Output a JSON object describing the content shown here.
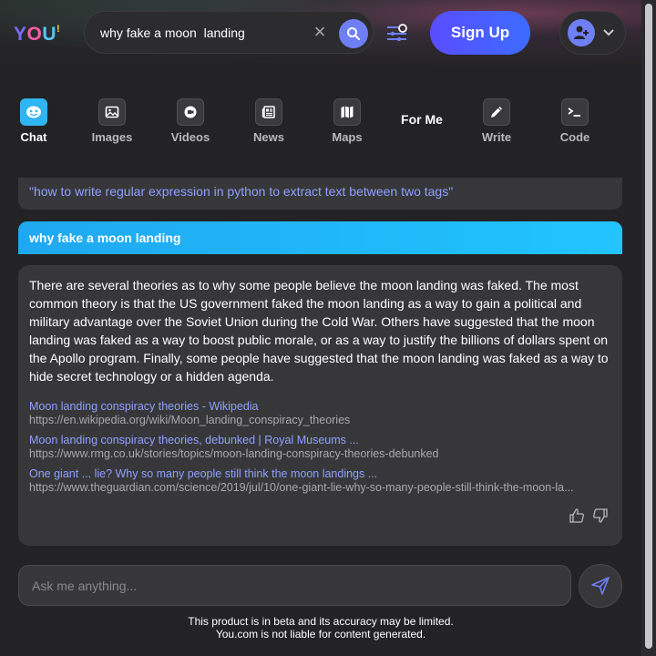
{
  "header": {
    "logo": {
      "y": "Y",
      "o": "O",
      "u": "U",
      "mark": "!"
    },
    "search_value": "why fake a moon  landing",
    "clear_label": "×",
    "signup_label": "Sign Up"
  },
  "tabs": [
    {
      "label": "Chat",
      "icon": "chat-icon",
      "active": true
    },
    {
      "label": "Images",
      "icon": "image-icon"
    },
    {
      "label": "Videos",
      "icon": "video-icon"
    },
    {
      "label": "News",
      "icon": "news-icon"
    },
    {
      "label": "Maps",
      "icon": "map-icon"
    },
    {
      "label": "For Me"
    },
    {
      "label": "Write",
      "icon": "pencil-icon"
    },
    {
      "label": "Code",
      "icon": "terminal-icon"
    }
  ],
  "chat": {
    "previous_query": "\"how to write regular expression in python to extract text between two tags\"",
    "current_query": "why fake a moon landing",
    "answer": "There are several theories as to why some people believe the moon landing was faked. The most common theory is that the US government faked the moon landing as a way to gain a political and military advantage over the Soviet Union during the Cold War. Others have suggested that the moon landing was faked as a way to boost public morale, or as a way to justify the billions of dollars spent on the Apollo program. Finally, some people have suggested that the moon landing was faked as a way to hide secret technology or a hidden agenda.",
    "sources": [
      {
        "title": "Moon landing conspiracy theories - Wikipedia",
        "url": "https://en.wikipedia.org/wiki/Moon_landing_conspiracy_theories"
      },
      {
        "title": "Moon landing conspiracy theories, debunked | Royal Museums ...",
        "url": "https://www.rmg.co.uk/stories/topics/moon-landing-conspiracy-theories-debunked"
      },
      {
        "title": "One giant ... lie? Why so many people still think the moon landings ...",
        "url": "https://www.theguardian.com/science/2019/jul/10/one-giant-lie-why-so-many-people-still-think-the-moon-la..."
      }
    ]
  },
  "input": {
    "placeholder": "Ask me anything..."
  },
  "disclaimer": {
    "line1": "This product is in beta and its accuracy may be limited.",
    "line2": "You.com is not liable for content generated."
  },
  "colors": {
    "accent": "#6f7ff5",
    "chat_tab": "#2fb5f2",
    "link": "#8fa0ff",
    "background": "#232325"
  }
}
